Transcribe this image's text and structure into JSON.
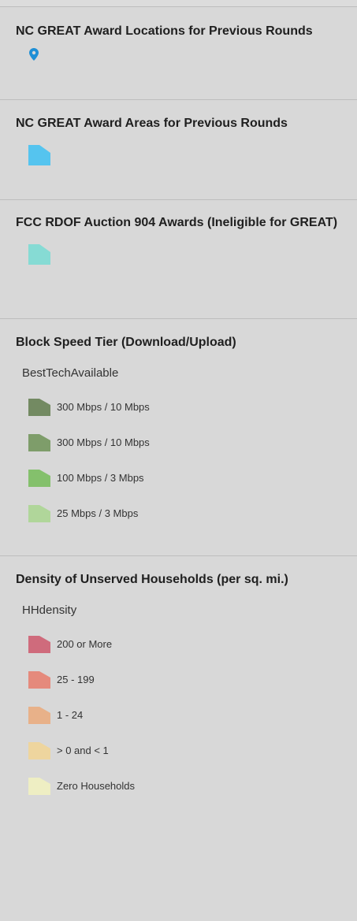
{
  "sections": {
    "locations": {
      "title": "NC GREAT Award Locations for Previous Rounds",
      "icon": "map-pin-icon",
      "color": "#1e8fd6"
    },
    "areas": {
      "title": "NC GREAT Award Areas for Previous Rounds",
      "icon": "polygon-swatch-icon",
      "color": "#55c4ef"
    },
    "rdof": {
      "title": "FCC RDOF Auction 904 Awards (Ineligible for GREAT)",
      "icon": "polygon-swatch-icon",
      "color": "#86dbd4"
    },
    "speed": {
      "title": "Block Speed Tier (Download/Upload)",
      "field": "BestTechAvailable",
      "items": [
        {
          "label": "300 Mbps / 10 Mbps",
          "color": "#738a62"
        },
        {
          "label": "300 Mbps / 10 Mbps",
          "color": "#7e9d6a"
        },
        {
          "label": "100 Mbps / 3 Mbps",
          "color": "#84c06c"
        },
        {
          "label": "25 Mbps / 3 Mbps",
          "color": "#b0d69a"
        }
      ]
    },
    "density": {
      "title": "Density of Unserved Households (per sq. mi.)",
      "field": "HHdensity",
      "items": [
        {
          "label": "200 or More",
          "color": "#cf6b7c"
        },
        {
          "label": "25 - 199",
          "color": "#e58a7c"
        },
        {
          "label": "1 - 24",
          "color": "#e8b189"
        },
        {
          "label": "> 0 and < 1",
          "color": "#eed59e"
        },
        {
          "label": "Zero Households",
          "color": "#eeeec3"
        }
      ]
    }
  }
}
